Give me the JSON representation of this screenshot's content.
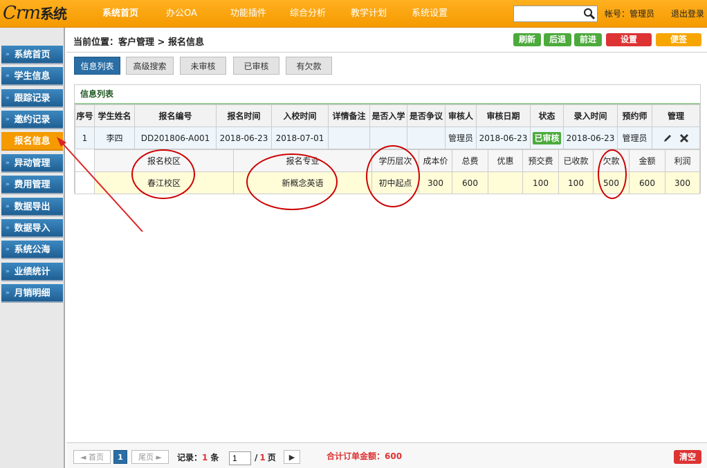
{
  "app": {
    "logo_text": "Crm",
    "logo_cn": "系统"
  },
  "topnav": [
    "系统首页",
    "办公OA",
    "功能插件",
    "综合分析",
    "教学计划",
    "系统设置"
  ],
  "search": {
    "placeholder": ""
  },
  "account": {
    "label": "帐号：管理员",
    "logout": "退出登录"
  },
  "sidebar": [
    "系统首页",
    "学生信息",
    "跟踪记录",
    "邀约记录",
    "报名信息",
    "异动管理",
    "费用管理",
    "数据导出",
    "数据导入",
    "系统公海",
    "业绩统计",
    "月销明细"
  ],
  "breadcrumb": "当前位置：客户管理 > 报名信息",
  "toolbar": {
    "refresh": "刷新",
    "back": "后退",
    "forward": "前进",
    "settings": "设置",
    "notes": "便签"
  },
  "tabs": [
    "信息列表",
    "高级搜索",
    "未审核",
    "已审核",
    "有欠款"
  ],
  "panel_title": "信息列表",
  "table": {
    "headers": [
      "序号",
      "学生姓名",
      "报名编号",
      "报名时间",
      "入校时间",
      "详情备注",
      "是否入学",
      "是否争议",
      "审核人",
      "审核日期",
      "状态",
      "录入时间",
      "预约师",
      "管理"
    ],
    "row": {
      "index": "1",
      "name": "李四",
      "code": "DD201806-A001",
      "signup": "2018-06-23",
      "entry": "2018-07-01",
      "note": "",
      "enrolled": "",
      "dispute": "",
      "auditor": "管理员",
      "audit_date": "2018-06-23",
      "status": "已审核",
      "input_date": "2018-06-23",
      "advisor": "管理员"
    }
  },
  "detail": {
    "headers": [
      "报名校区",
      "报名专业",
      "学历层次",
      "成本价",
      "总费",
      "优惠",
      "预交费",
      "已收款",
      "欠款",
      "金额",
      "利润"
    ],
    "values": [
      "春江校区",
      "新概念英语",
      "初中起点",
      "300",
      "600",
      "",
      "100",
      "100",
      "500",
      "600",
      "300"
    ]
  },
  "footer": {
    "first": "◄ 首页",
    "page": "1",
    "last": "尾页 ►",
    "record_label": "记录：",
    "record_count": "1",
    "record_unit": "条",
    "page_input": "1",
    "page_total_sep": "/",
    "page_total": "1",
    "page_unit": "页",
    "go": "▶",
    "total_label": "合计订单金额：",
    "total_value": "600",
    "clear": "清空"
  }
}
